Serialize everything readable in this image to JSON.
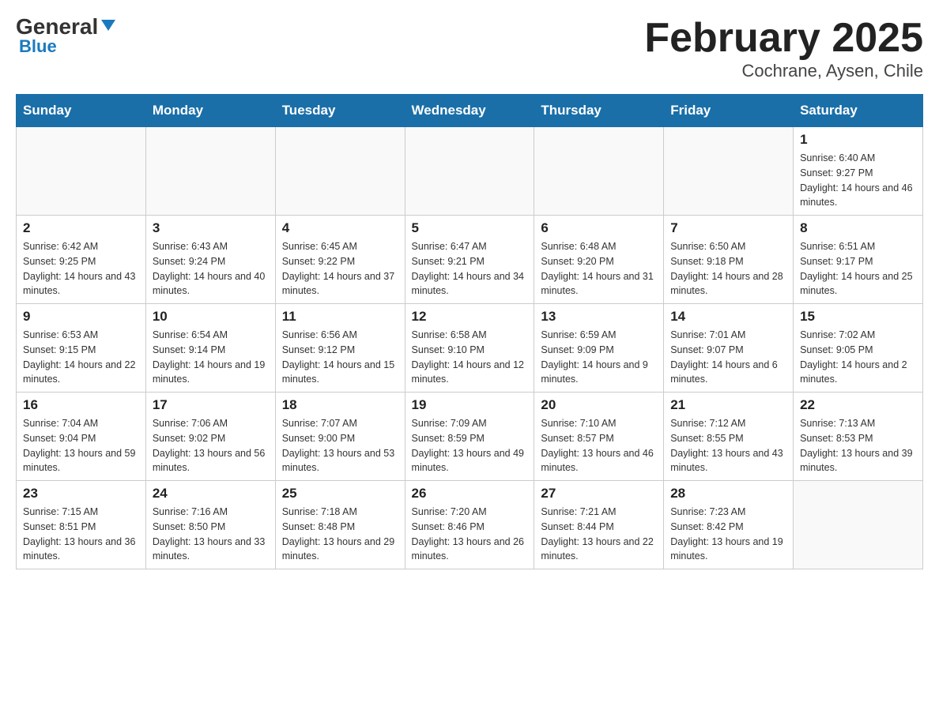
{
  "logo": {
    "general": "General",
    "blue": "Blue"
  },
  "title": "February 2025",
  "subtitle": "Cochrane, Aysen, Chile",
  "weekdays": [
    "Sunday",
    "Monday",
    "Tuesday",
    "Wednesday",
    "Thursday",
    "Friday",
    "Saturday"
  ],
  "weeks": [
    [
      {
        "day": "",
        "info": ""
      },
      {
        "day": "",
        "info": ""
      },
      {
        "day": "",
        "info": ""
      },
      {
        "day": "",
        "info": ""
      },
      {
        "day": "",
        "info": ""
      },
      {
        "day": "",
        "info": ""
      },
      {
        "day": "1",
        "info": "Sunrise: 6:40 AM\nSunset: 9:27 PM\nDaylight: 14 hours and 46 minutes."
      }
    ],
    [
      {
        "day": "2",
        "info": "Sunrise: 6:42 AM\nSunset: 9:25 PM\nDaylight: 14 hours and 43 minutes."
      },
      {
        "day": "3",
        "info": "Sunrise: 6:43 AM\nSunset: 9:24 PM\nDaylight: 14 hours and 40 minutes."
      },
      {
        "day": "4",
        "info": "Sunrise: 6:45 AM\nSunset: 9:22 PM\nDaylight: 14 hours and 37 minutes."
      },
      {
        "day": "5",
        "info": "Sunrise: 6:47 AM\nSunset: 9:21 PM\nDaylight: 14 hours and 34 minutes."
      },
      {
        "day": "6",
        "info": "Sunrise: 6:48 AM\nSunset: 9:20 PM\nDaylight: 14 hours and 31 minutes."
      },
      {
        "day": "7",
        "info": "Sunrise: 6:50 AM\nSunset: 9:18 PM\nDaylight: 14 hours and 28 minutes."
      },
      {
        "day": "8",
        "info": "Sunrise: 6:51 AM\nSunset: 9:17 PM\nDaylight: 14 hours and 25 minutes."
      }
    ],
    [
      {
        "day": "9",
        "info": "Sunrise: 6:53 AM\nSunset: 9:15 PM\nDaylight: 14 hours and 22 minutes."
      },
      {
        "day": "10",
        "info": "Sunrise: 6:54 AM\nSunset: 9:14 PM\nDaylight: 14 hours and 19 minutes."
      },
      {
        "day": "11",
        "info": "Sunrise: 6:56 AM\nSunset: 9:12 PM\nDaylight: 14 hours and 15 minutes."
      },
      {
        "day": "12",
        "info": "Sunrise: 6:58 AM\nSunset: 9:10 PM\nDaylight: 14 hours and 12 minutes."
      },
      {
        "day": "13",
        "info": "Sunrise: 6:59 AM\nSunset: 9:09 PM\nDaylight: 14 hours and 9 minutes."
      },
      {
        "day": "14",
        "info": "Sunrise: 7:01 AM\nSunset: 9:07 PM\nDaylight: 14 hours and 6 minutes."
      },
      {
        "day": "15",
        "info": "Sunrise: 7:02 AM\nSunset: 9:05 PM\nDaylight: 14 hours and 2 minutes."
      }
    ],
    [
      {
        "day": "16",
        "info": "Sunrise: 7:04 AM\nSunset: 9:04 PM\nDaylight: 13 hours and 59 minutes."
      },
      {
        "day": "17",
        "info": "Sunrise: 7:06 AM\nSunset: 9:02 PM\nDaylight: 13 hours and 56 minutes."
      },
      {
        "day": "18",
        "info": "Sunrise: 7:07 AM\nSunset: 9:00 PM\nDaylight: 13 hours and 53 minutes."
      },
      {
        "day": "19",
        "info": "Sunrise: 7:09 AM\nSunset: 8:59 PM\nDaylight: 13 hours and 49 minutes."
      },
      {
        "day": "20",
        "info": "Sunrise: 7:10 AM\nSunset: 8:57 PM\nDaylight: 13 hours and 46 minutes."
      },
      {
        "day": "21",
        "info": "Sunrise: 7:12 AM\nSunset: 8:55 PM\nDaylight: 13 hours and 43 minutes."
      },
      {
        "day": "22",
        "info": "Sunrise: 7:13 AM\nSunset: 8:53 PM\nDaylight: 13 hours and 39 minutes."
      }
    ],
    [
      {
        "day": "23",
        "info": "Sunrise: 7:15 AM\nSunset: 8:51 PM\nDaylight: 13 hours and 36 minutes."
      },
      {
        "day": "24",
        "info": "Sunrise: 7:16 AM\nSunset: 8:50 PM\nDaylight: 13 hours and 33 minutes."
      },
      {
        "day": "25",
        "info": "Sunrise: 7:18 AM\nSunset: 8:48 PM\nDaylight: 13 hours and 29 minutes."
      },
      {
        "day": "26",
        "info": "Sunrise: 7:20 AM\nSunset: 8:46 PM\nDaylight: 13 hours and 26 minutes."
      },
      {
        "day": "27",
        "info": "Sunrise: 7:21 AM\nSunset: 8:44 PM\nDaylight: 13 hours and 22 minutes."
      },
      {
        "day": "28",
        "info": "Sunrise: 7:23 AM\nSunset: 8:42 PM\nDaylight: 13 hours and 19 minutes."
      },
      {
        "day": "",
        "info": ""
      }
    ]
  ]
}
